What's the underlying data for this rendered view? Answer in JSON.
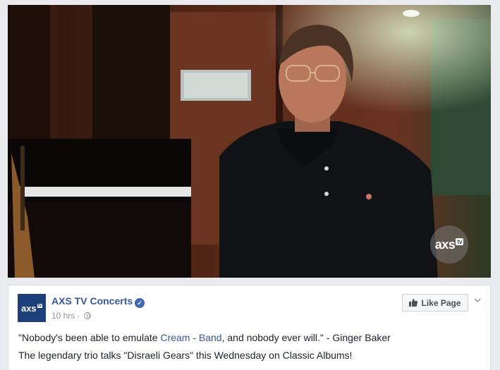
{
  "video": {
    "watermark_main": "axs",
    "watermark_tv": "tv"
  },
  "post": {
    "avatar_main": "axs",
    "avatar_tv": "tv",
    "page_name": "AXS TV Concerts",
    "verified_glyph": "✓",
    "time": "10 hrs",
    "separator": " · ",
    "privacy_icon": "globe-icon",
    "like_label": "Like Page",
    "line1_before": "\"Nobody's been able to emulate ",
    "line1_link": "Cream - Band",
    "line1_after": ", and nobody ever will.\" - Ginger Baker",
    "line2": "The legendary trio talks \"Disraeli Gears\" this Wednesday on Classic Albums!"
  },
  "colors": {
    "link": "#365899",
    "verified": "#4267b2",
    "avatar_bg": "#1d3f7a"
  }
}
